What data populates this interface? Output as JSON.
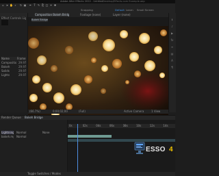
{
  "app": {
    "title": "Adobe After Effects 2022 - Untitled",
    "title_right": "Desktop/Effects.com Example.aep"
  },
  "workspaces": {
    "items": [
      {
        "label": "Snapping",
        "active": false
      },
      {
        "label": "Default",
        "active": true
      },
      {
        "label": "Learn",
        "active": false
      },
      {
        "label": "Small Screen",
        "active": false
      }
    ]
  },
  "project": {
    "effect_controls_label": "Effect Controls Lightning",
    "col_name": "Name",
    "col_fps": "Frame Rate",
    "rows": [
      {
        "name": "Composition",
        "fps": "29.97"
      },
      {
        "name": "Bokeh",
        "fps": "29.97"
      },
      {
        "name": "Solids",
        "fps": "29.97"
      },
      {
        "name": "Lights",
        "fps": "29.97"
      }
    ]
  },
  "viewer": {
    "tab_composition": "Composition Bokeh Bridge",
    "tab_footage": "Footage (none)",
    "tab_layer": "Layer (none)",
    "subtab": "Bokeh Bridge",
    "zoom": "(66.7%)",
    "timecode": "0;00;02;00",
    "resolution": "(Full)",
    "camera": "Active Camera",
    "view": "1 View"
  },
  "timeline": {
    "tab_render": "Render Queue",
    "tab_comp": "Bokeh Bridge",
    "layer_name": "Lightning",
    "layer_mode": "Normal",
    "layer2_name": "bokeh.mp4",
    "layer2_mode": "Normal",
    "parent_label": "None",
    "toggle_label": "Toggle Switches / Modes",
    "ruler": [
      "0s",
      "02s",
      "04s",
      "06s",
      "08s",
      "10s",
      "12s",
      "14s"
    ]
  },
  "brand": {
    "logo_text": "ESSO",
    "logo_suffix": "4"
  }
}
